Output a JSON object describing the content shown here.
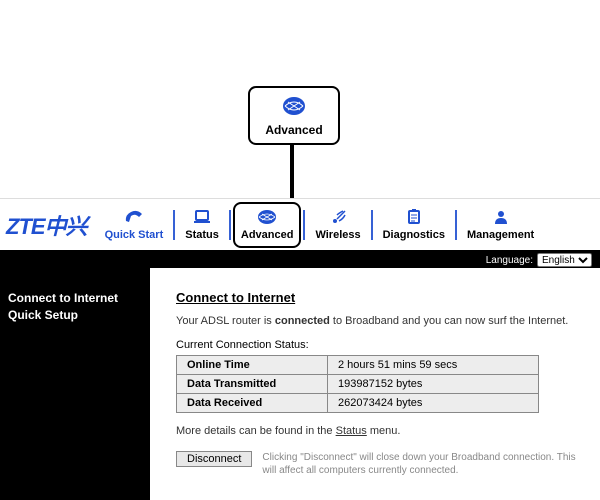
{
  "callout": {
    "label": "Advanced"
  },
  "logo_text": "ZTE中兴",
  "nav": [
    {
      "key": "quickstart",
      "label": "Quick Start"
    },
    {
      "key": "status",
      "label": "Status"
    },
    {
      "key": "advanced",
      "label": "Advanced"
    },
    {
      "key": "wireless",
      "label": "Wireless"
    },
    {
      "key": "diagnostics",
      "label": "Diagnostics"
    },
    {
      "key": "management",
      "label": "Management"
    }
  ],
  "language": {
    "label": "Language:",
    "selected": "English"
  },
  "sidebar": {
    "items": [
      {
        "key": "connect",
        "label": "Connect to Internet"
      },
      {
        "key": "quicksetup",
        "label": "Quick Setup"
      }
    ]
  },
  "content": {
    "title": "Connect to Internet",
    "intro_prefix": "Your ADSL router is ",
    "intro_bold": "connected",
    "intro_suffix": " to Broadband and you can now surf the Internet.",
    "status_heading": "Current Connection Status:",
    "rows": [
      {
        "label": "Online Time",
        "value": "2 hours 51 mins 59 secs"
      },
      {
        "label": "Data Transmitted",
        "value": "193987152 bytes"
      },
      {
        "label": "Data Received",
        "value": "262073424 bytes"
      }
    ],
    "note_prefix": "More details can be found in the ",
    "note_link": "Status",
    "note_suffix": " menu.",
    "disconnect_label": "Disconnect",
    "disconnect_hint": "Clicking \"Disconnect\" will close down your Broadband connection. This will affect all computers currently connected."
  },
  "colors": {
    "accent": "#2050d0"
  }
}
